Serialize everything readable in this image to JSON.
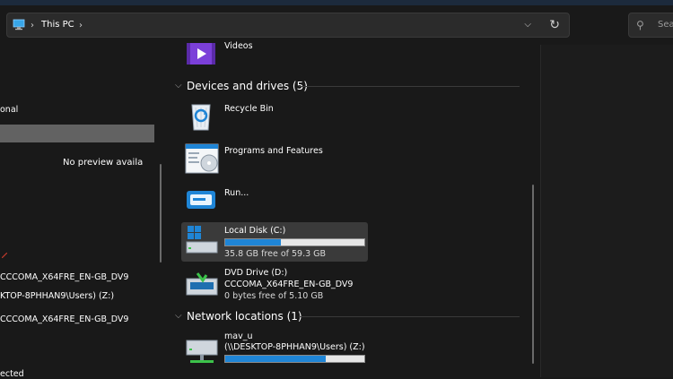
{
  "address": {
    "location": "This PC",
    "icons": {
      "pc": "monitor-icon",
      "separator": "chevron-right-icon",
      "dropdown": "chevron-down-icon",
      "refresh": "refresh-icon"
    }
  },
  "search": {
    "placeholder": "Sea",
    "icon": "search-icon"
  },
  "nav": {
    "items": [
      {
        "label": "onal"
      },
      {
        "label": ""
      },
      {
        "label": "CCCOMA_X64FRE_EN-GB_DV9"
      },
      {
        "label": "KTOP-8PHHAN9\\Users) (Z:)"
      },
      {
        "label": "CCCOMA_X64FRE_EN-GB_DV9"
      },
      {
        "label": "ected"
      }
    ]
  },
  "content": {
    "videos": {
      "name": "Videos"
    },
    "devices_header": "Devices and drives (5)",
    "devices": [
      {
        "name": "Recycle Bin",
        "icon": "recycle-bin-icon"
      },
      {
        "name": "Programs and Features",
        "icon": "programs-features-icon"
      },
      {
        "name": "Run...",
        "icon": "run-icon"
      },
      {
        "name": "Local Disk (C:)",
        "sub": "35.8 GB free of 59.3 GB",
        "fill": 0.4,
        "icon": "windows-drive-icon"
      },
      {
        "name": "DVD Drive (D:)",
        "line2": "CCCOMA_X64FRE_EN-GB_DV9",
        "sub": "0 bytes free of 5.10 GB",
        "icon": "dvd-drive-icon"
      }
    ],
    "network_header": "Network locations (1)",
    "network": [
      {
        "name": "mav_u",
        "line2": "(\\\\DESKTOP-8PHHAN9\\Users) (Z:)",
        "fill": 0.72,
        "icon": "network-drive-icon"
      }
    ]
  },
  "preview": {
    "text": "No preview availa"
  },
  "colors": {
    "bar_fill": "#1f85d6",
    "background": "#191919",
    "selected": "#3a3a3a"
  }
}
